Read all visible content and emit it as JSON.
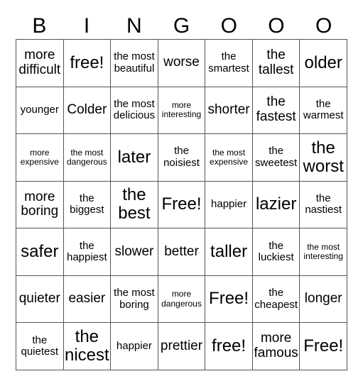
{
  "header": [
    "B",
    "I",
    "N",
    "G",
    "O",
    "O",
    "O"
  ],
  "cells": [
    [
      "more difficult",
      "free!",
      "the most beautiful",
      "worse",
      "the smartest",
      "the tallest",
      "older"
    ],
    [
      "younger",
      "Colder",
      "the most delicious",
      "more interesting",
      "shorter",
      "the fastest",
      "the warmest"
    ],
    [
      "more expensive",
      "the most dangerous",
      "later",
      "the noisiest",
      "the most expensive",
      "the sweetest",
      "the worst"
    ],
    [
      "more boring",
      "the biggest",
      "the best",
      "Free!",
      "happier",
      "lazier",
      "the nastiest"
    ],
    [
      "safer",
      "the happiest",
      "slower",
      "better",
      "taller",
      "the luckiest",
      "the most interesting"
    ],
    [
      "quieter",
      "easier",
      "the most boring",
      "more dangerous",
      "Free!",
      "the cheapest",
      "longer"
    ],
    [
      "the quietest",
      "the nicest",
      "happier",
      "prettier",
      "free!",
      "more famous",
      "Free!"
    ]
  ]
}
